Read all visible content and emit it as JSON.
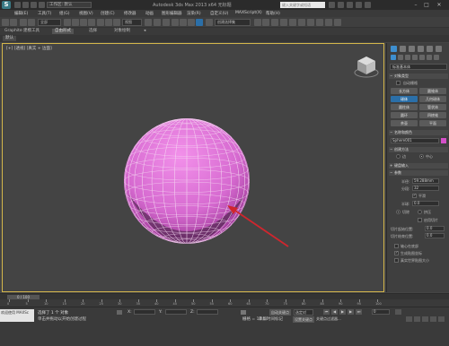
{
  "titlebar": {
    "logo": "S",
    "workspace": "工作区: 默认",
    "title": "Autodesk 3ds Max 2013 x64     无标题",
    "search_placeholder": "键入关键字或短语"
  },
  "menubar": [
    "编辑(E)",
    "工具(T)",
    "组(G)",
    "视图(V)",
    "创建(C)",
    "修改器",
    "动画",
    "图形编辑器",
    "渲染(R)",
    "自定义(U)",
    "MAXScript(X)",
    "帮助(H)"
  ],
  "toolbar": {
    "selection_filter": "全部",
    "view_dropdown": "视图",
    "named_sets": "创建选择集"
  },
  "ribbon": {
    "tabs": [
      "Graphite 建模工具",
      "自由形式",
      "选择",
      "对象绘制"
    ],
    "active_tab": 1,
    "subtab": "默认"
  },
  "viewport": {
    "label": "[+] [透视] [真实 + 边面]",
    "border_color": "#d4b64a",
    "sphere_color": "#e070d8",
    "arrow_color": "#d0262e"
  },
  "command_panel": {
    "category_select": "标准基本体",
    "object_type_header": "对象类型",
    "autogrid_label": "自动栅格",
    "object_buttons": [
      "长方体",
      "圆锥体",
      "球体",
      "几何球体",
      "圆柱体",
      "管状体",
      "圆环",
      "四棱锥",
      "茶壶",
      "平面"
    ],
    "active_object_button": 2,
    "name_color_header": "名称和颜色",
    "object_name": "Sphere001",
    "object_color": "#d450c8",
    "creation_method_header": "创建方法",
    "creation_edge": "边",
    "creation_center": "中心",
    "keyboard_entry_header": "键盘输入",
    "params_header": "参数",
    "radius_label": "半径:",
    "radius_value": "59.288mm",
    "segments_label": "分段:",
    "segments_value": "32",
    "smooth_label": "平滑",
    "hemisphere_label": "半球:",
    "hemisphere_value": "0.0",
    "chop_label": "切除",
    "squash_label": "挤压",
    "slice_label": "启用切片",
    "base_to_pivot_label": "轴心在底部",
    "gen_mapping_label": "生成贴图坐标",
    "real_world_label": "真实世界贴图大小",
    "slice_from_label": "切片起始位置:",
    "slice_to_label": "切片结束位置:",
    "slice_from_value": "0.0",
    "slice_to_value": "0.0"
  },
  "timeline": {
    "slider_label": "0 / 100",
    "ticks": [
      "0",
      "5",
      "10",
      "15",
      "20",
      "25",
      "30",
      "35",
      "40",
      "45",
      "50",
      "55",
      "60",
      "65",
      "70",
      "75",
      "80",
      "85",
      "90",
      "95",
      "100"
    ]
  },
  "statusbar": {
    "maxscript": "欢迎使用 MAXSc",
    "status1": "选择了 1 个 对象",
    "status2": "单击并拖动以开始创建过程",
    "x_label": "X:",
    "y_label": "Y:",
    "z_label": "Z:",
    "grid": "栅格 = 10.0",
    "autokey": "自动关键点",
    "setkey": "设置关键点",
    "selected": "选定对",
    "addtime": "添加时间标记",
    "keyfilter": "关键点过滤器...",
    "frame": "0"
  }
}
